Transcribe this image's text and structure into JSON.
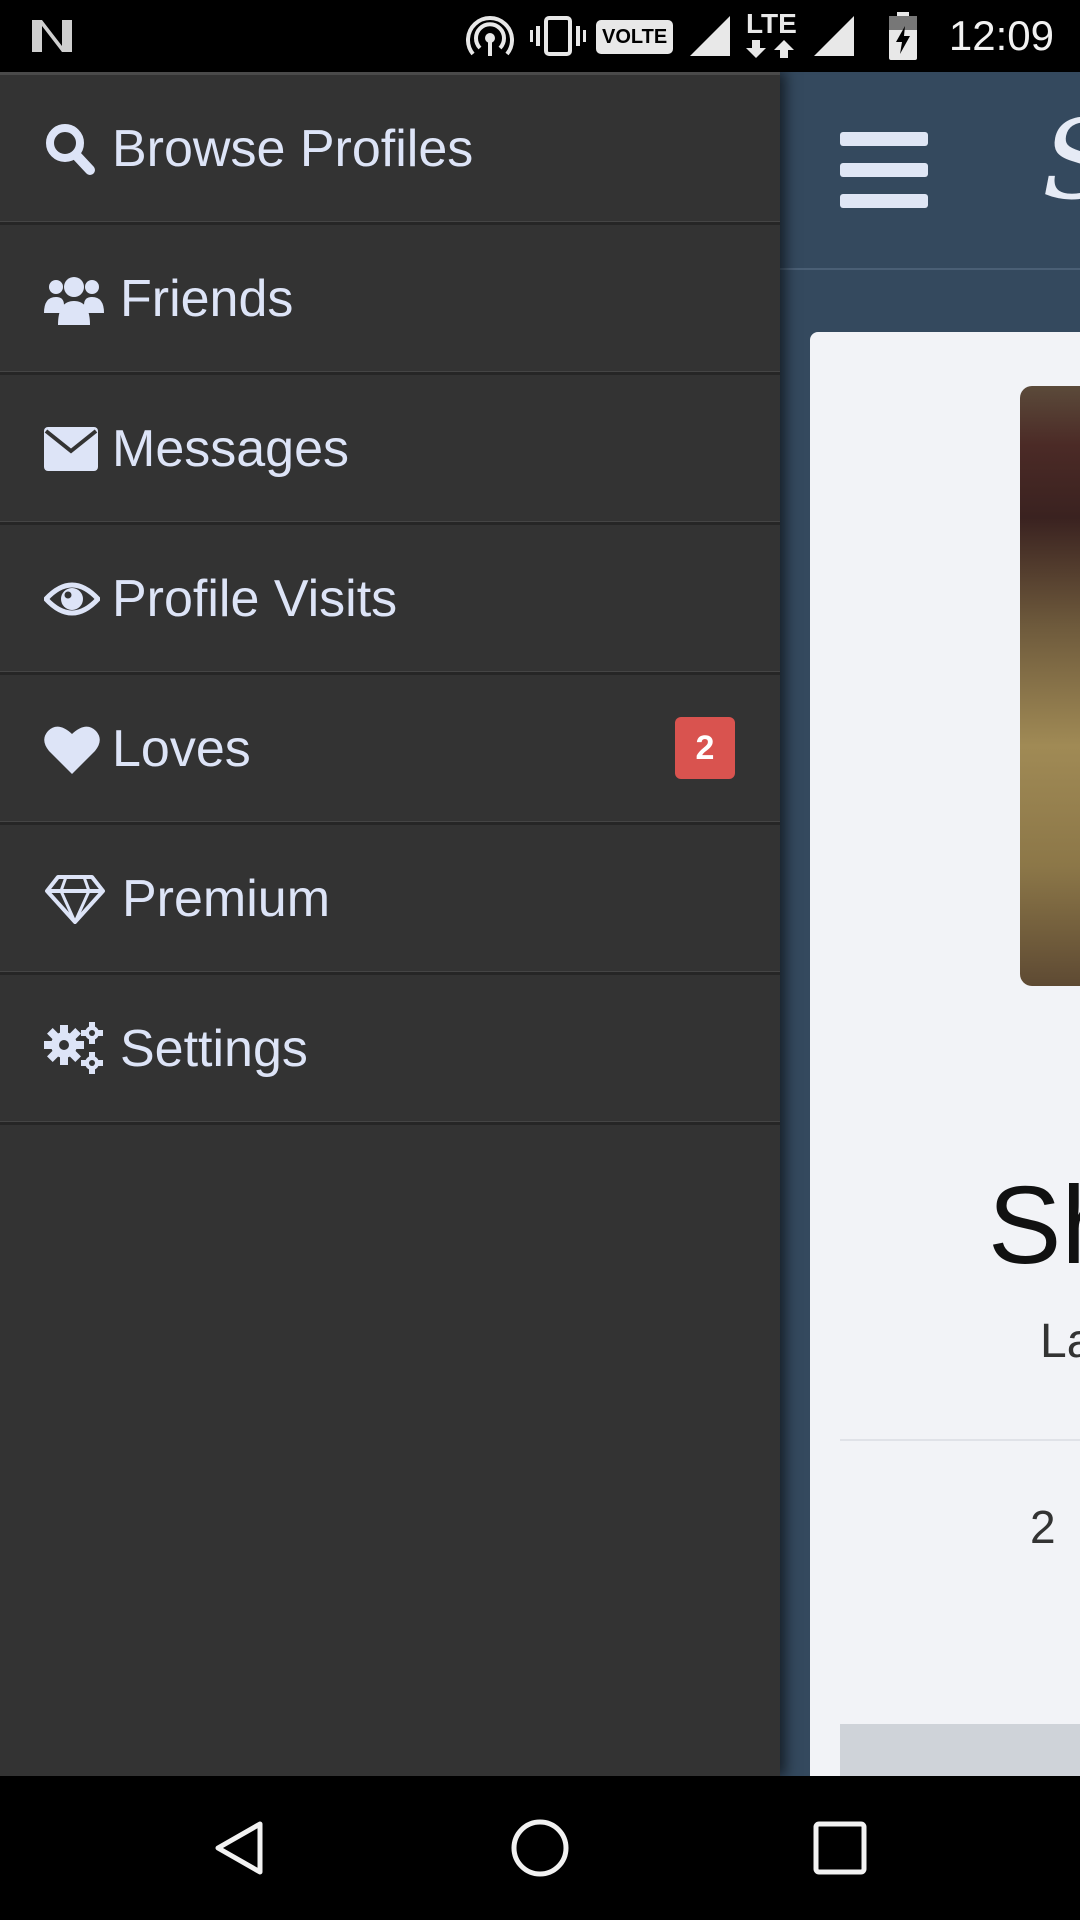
{
  "status_bar": {
    "time": "12:09",
    "volte_label": "VOLTE",
    "lte_label": "LTE",
    "icons": [
      "notification-n-icon",
      "hotspot-icon",
      "vibrate-icon",
      "volte-icon",
      "signal-icon",
      "lte-icon",
      "signal-icon",
      "battery-charging-icon"
    ]
  },
  "drawer": {
    "items": [
      {
        "label": "Browse Profiles",
        "icon": "search-icon"
      },
      {
        "label": "Friends",
        "icon": "users-icon"
      },
      {
        "label": "Messages",
        "icon": "envelope-icon"
      },
      {
        "label": "Profile Visits",
        "icon": "eye-icon"
      },
      {
        "label": "Loves",
        "icon": "heart-icon",
        "badge": "2"
      },
      {
        "label": "Premium",
        "icon": "diamond-icon"
      },
      {
        "label": "Settings",
        "icon": "gears-icon"
      }
    ]
  },
  "app": {
    "logo_glyph": "S",
    "profile_name_partial": "Sh",
    "profile_sub_partial": "La",
    "profile_stat_partial": "2"
  },
  "nav_bar": {
    "icons": [
      "back-icon",
      "home-icon",
      "recents-icon"
    ]
  },
  "colors": {
    "drawer_bg": "#333333",
    "drawer_text": "#dde4f7",
    "badge": "#d9534f",
    "app_header": "#34495e",
    "card_bg": "#f2f3f7"
  }
}
